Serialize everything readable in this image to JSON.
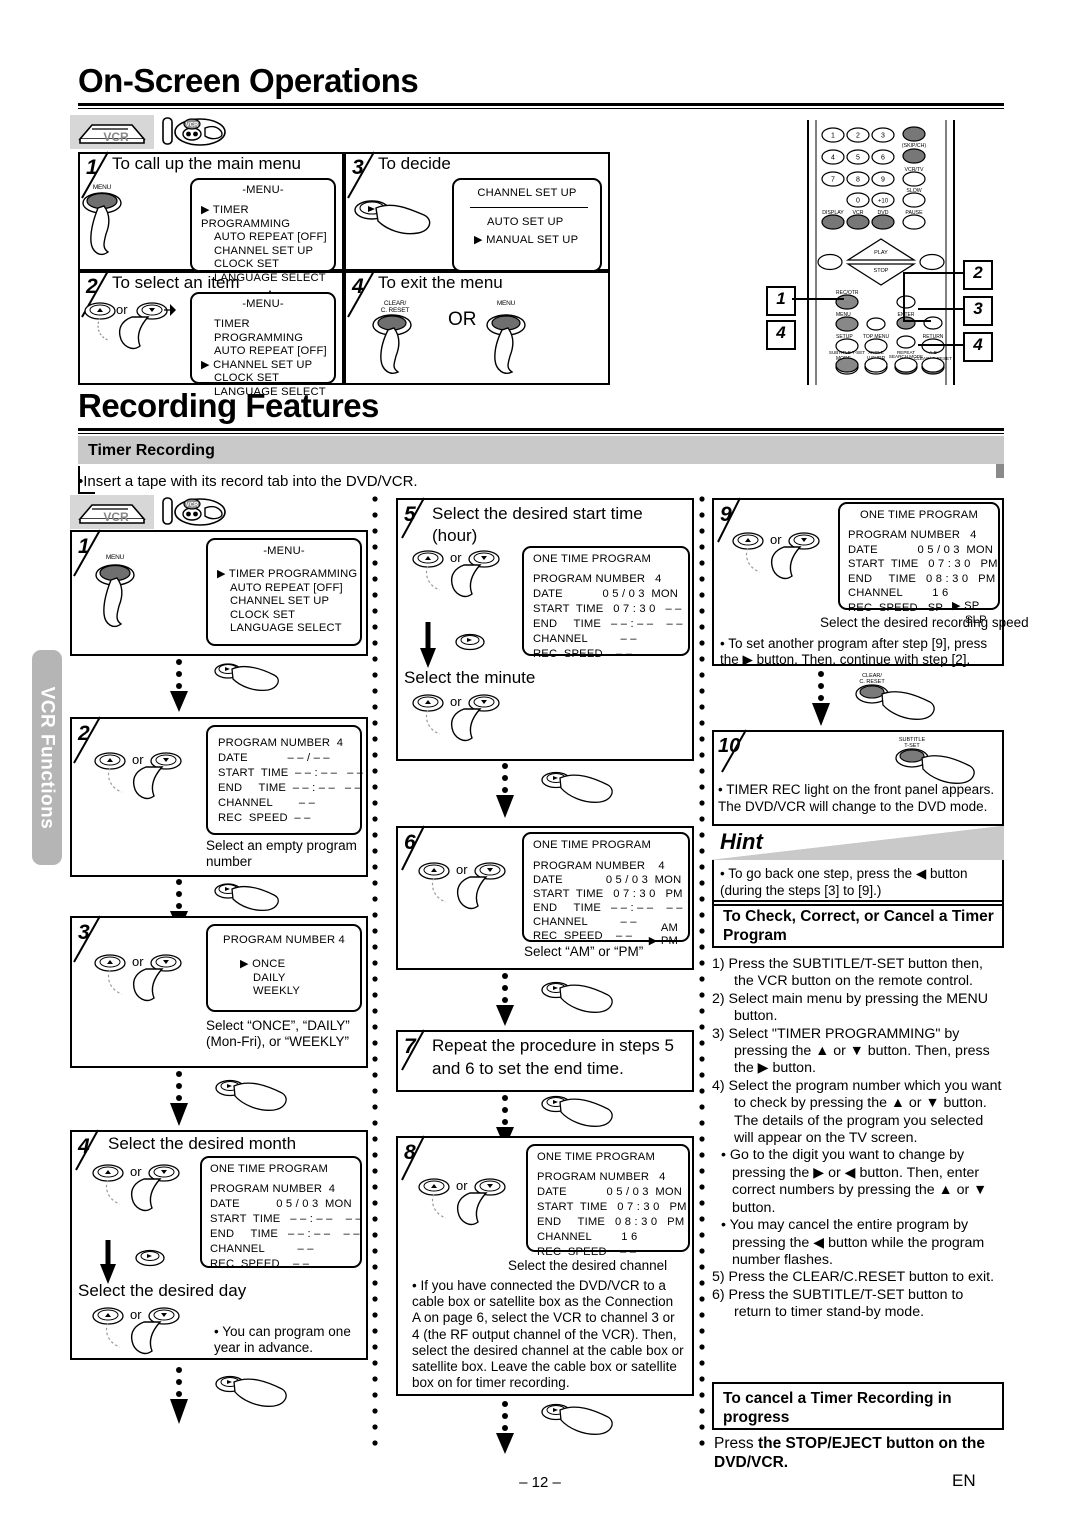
{
  "page": {
    "number": "– 12 –",
    "lang_mark": "EN",
    "side_tab": "VCR Functions"
  },
  "section1": {
    "title": "On-Screen Operations",
    "device_badge": "VCR",
    "steps": [
      {
        "num": "1",
        "heading": "To call up the main menu",
        "button": "MENU",
        "osd": {
          "title": "-MENU-",
          "items": [
            "TIMER PROGRAMMING",
            "AUTO REPEAT  [OFF]",
            "CHANNEL SET UP",
            "CLOCK SET",
            "LANGUAGE SELECT"
          ],
          "cursor_index": 0
        }
      },
      {
        "num": "3",
        "heading": "To decide",
        "osd": {
          "title": "CHANNEL SET UP",
          "items": [
            "AUTO SET UP",
            "MANUAL SET UP"
          ],
          "cursor_index": 1
        }
      },
      {
        "num": "2",
        "heading": "To select an item",
        "or_label": "or",
        "osd": {
          "title": "-MENU-",
          "items": [
            "TIMER PROGRAMMING",
            "AUTO REPEAT  [OFF]",
            "CHANNEL SET UP",
            "CLOCK SET",
            "LANGUAGE SELECT"
          ],
          "cursor_index": 2
        }
      },
      {
        "num": "4",
        "heading": "To exit the menu",
        "button_left": "CLEAR/\nC. RESET",
        "or_label": "OR",
        "button_right": "MENU"
      }
    ]
  },
  "remote": {
    "callouts": [
      "1",
      "2",
      "3",
      "4",
      "4"
    ],
    "number_keys": [
      "1",
      "2",
      "3",
      "4",
      "5",
      "6",
      "7",
      "8",
      "9",
      "0",
      "+10"
    ],
    "labels": {
      "skip_ch": "(SKIP/CH)",
      "vcr_tv": "VCR/TV",
      "slow": "SLOW",
      "display": "DISPLAY",
      "vcr": "VCR",
      "dvd": "DVD",
      "pause": "PAUSE",
      "play": "PLAY",
      "stop": "STOP",
      "rec_otr": "REC/OTR",
      "menu": "MENU",
      "enter": "ENTER",
      "setup": "SETUP",
      "top_menu": "TOP MENU",
      "return": "RETURN",
      "mode": "MODE",
      "v_surr": "V.SURR",
      "search_mode": "SEARCH MODE",
      "clear_creset": "CLEAR/ C.RESET",
      "subtitle_tset": "SUBTITLE T-SET",
      "angle": "ANGLE",
      "repeat": "REPEAT",
      "ab": "A-B"
    }
  },
  "section2": {
    "title": "Recording Features",
    "subhead": "Timer Recording",
    "intro": "•Insert a tape with its record tab into the DVD/VCR.",
    "device_badge": "VCR",
    "steps": {
      "s1": {
        "num": "1",
        "button": "MENU",
        "osd": {
          "title": "-MENU-",
          "items": [
            "TIMER PROGRAMMING",
            "AUTO REPEAT  [OFF]",
            "CHANNEL SET UP",
            "CLOCK SET",
            "LANGUAGE SELECT"
          ],
          "cursor_index": 0
        }
      },
      "s2": {
        "num": "2",
        "or_label": "or",
        "osd_rows": [
          "PROGRAM NUMBER  4",
          "DATE            – – / – –",
          "START  TIME  – – : – –   – –",
          "END     TIME  – – : – –   – –",
          "CHANNEL        – –",
          "REC  SPEED  – –"
        ],
        "caption": "Select an empty program number"
      },
      "s3": {
        "num": "3",
        "or_label": "or",
        "osd": {
          "title": "PROGRAM  NUMBER  4",
          "items": [
            "ONCE",
            "DAILY",
            "WEEKLY"
          ],
          "cursor_index": 0
        },
        "caption": "Select “ONCE”, “DAILY” (Mon-Fri), or “WEEKLY”"
      },
      "s4": {
        "num": "4",
        "heading": "Select the desired month",
        "or_label": "or",
        "sub_heading": "Select the desired day",
        "osd": {
          "title": "ONE TIME PROGRAM",
          "rows": [
            "PROGRAM NUMBER  4",
            "DATE           0 5 / 0 3  MON",
            "START  TIME   – – : – –    – –",
            "END     TIME   – – : – –    – –",
            "CHANNEL          – –",
            "REC  SPEED    – –"
          ]
        },
        "note": "• You can program one   year in advance."
      },
      "s5": {
        "num": "5",
        "heading": "Select the desired start time (hour)",
        "or_label": "or",
        "sub_heading": "Select the minute",
        "osd": {
          "title": "ONE TIME PROGRAM",
          "rows": [
            "PROGRAM NUMBER   4",
            "DATE            0 5 / 0 3  MON",
            "START  TIME   0 7 : 3 0   – –",
            "END     TIME   – – : – –    – –",
            "CHANNEL          – –",
            "REC  SPEED    – –"
          ]
        }
      },
      "s6": {
        "num": "6",
        "or_label": "or",
        "osd": {
          "title": "ONE TIME PROGRAM",
          "rows": [
            "PROGRAM NUMBER    4",
            "DATE             0 5 / 0 3  MON",
            "START  TIME   0 7 : 3 0   PM",
            "END     TIME   – – : – –    – –",
            "CHANNEL          – –",
            "REC  SPEED    – –"
          ],
          "ampm": [
            "AM",
            "PM"
          ],
          "ampm_cursor_index": 1
        },
        "caption": "Select “AM” or “PM”"
      },
      "s7": {
        "num": "7",
        "heading": "Repeat the procedure in steps 5 and 6 to set the end time."
      },
      "s8": {
        "num": "8",
        "or_label": "or",
        "osd": {
          "title": "ONE TIME PROGRAM",
          "rows": [
            "PROGRAM NUMBER   4",
            "DATE            0 5 / 0 3  MON",
            "START  TIME   0 7 : 3 0   PM",
            "END     TIME   0 8 : 3 0   PM",
            "CHANNEL         1 6",
            "REC  SPEED    – –"
          ]
        },
        "caption": "Select the desired channel",
        "note": "• If you have connected the DVD/VCR to a cable box or satellite box as the Connection A on page 6, select the VCR to channel 3 or 4 (the RF output channel of the VCR). Then, select the desired channel at the cable box or satellite box. Leave the cable box or satellite box on for timer recording."
      },
      "s9": {
        "num": "9",
        "or_label": "or",
        "osd": {
          "title": "ONE TIME PROGRAM",
          "rows": [
            "PROGRAM NUMBER   4",
            "DATE            0 5 / 0 3  MON",
            "START  TIME   0 7 : 3 0   PM",
            "END     TIME   0 8 : 3 0   PM",
            "CHANNEL         1 6",
            "REC  SPEED   SP"
          ],
          "speed_options": [
            "SP",
            "SLP"
          ],
          "speed_cursor_index": 0
        },
        "caption": "Select the desired recording speed",
        "note": "• To set another program after step [9], press the ▶ button. Then, continue with step [2]."
      },
      "s10": {
        "num": "10",
        "button": "SUBTITLE T-SET",
        "note": "• TIMER REC light on the front panel appears. The DVD/VCR will change to the DVD mode."
      }
    },
    "connector_buttons": {
      "right_arrow": "▶",
      "clear_creset": "CLEAR/ C. RESET"
    },
    "hint": {
      "title": "Hint",
      "text": "• To go back one step, press the ◀ button (during the steps [3] to [9].)"
    },
    "check_box": {
      "title": "To Check, Correct, or Cancel a Timer Program",
      "items": [
        "1) Press the SUBTITLE/T-SET button then, the VCR button on the remote control.",
        "2) Select main menu by pressing the MENU button.",
        "3) Select \"TIMER PROGRAMMING\" by pressing the ▲ or ▼ button. Then, press the ▶ button.",
        "4) Select the program number which you want to check by pressing the ▲ or ▼ button. The details of the program you selected will appear on the TV screen.",
        "• Go to the digit you want to change by pressing the ▶ or ◀ button. Then, enter correct numbers by pressing the ▲ or ▼ button.",
        "• You may cancel the entire program by pressing the ◀ button while the program number flashes.",
        "5) Press the CLEAR/C.RESET button to exit.",
        "6) Press the SUBTITLE/T-SET button to return to timer stand-by mode."
      ]
    },
    "cancel_box": {
      "title": "To cancel a Timer Recording in progress",
      "text_light": "Press ",
      "text_bold": "the STOP/EJECT button on the DVD/VCR."
    }
  }
}
